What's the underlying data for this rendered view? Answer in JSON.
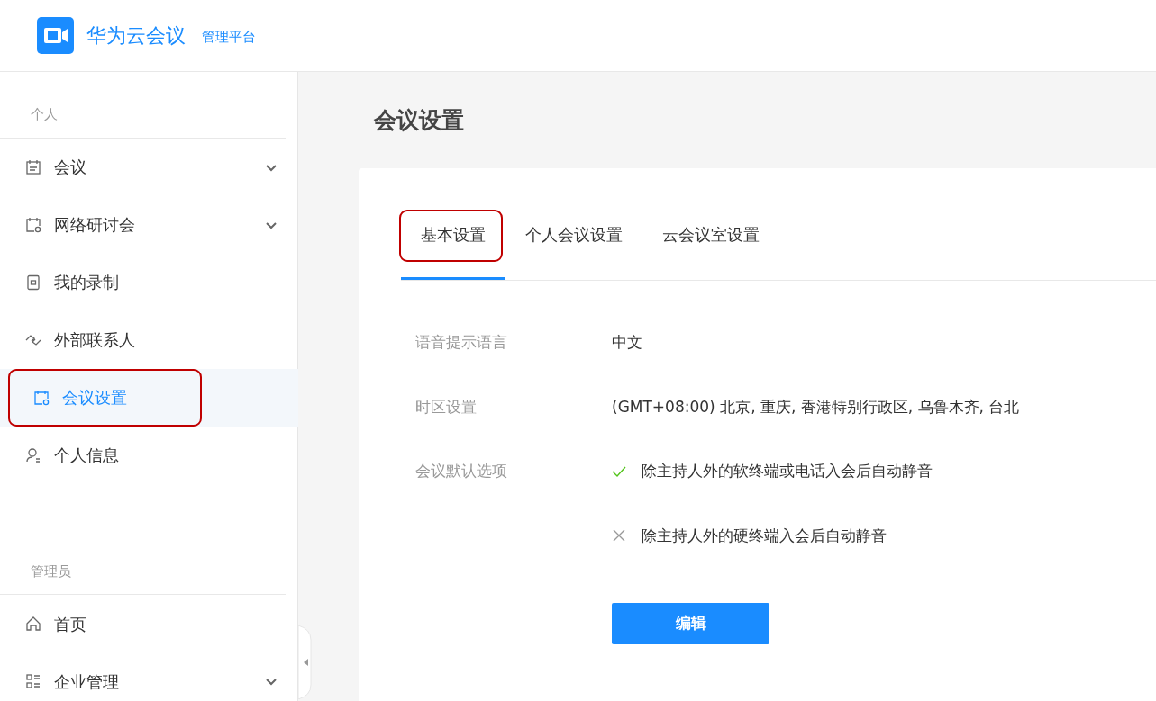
{
  "header": {
    "product": "华为云会议",
    "subtitle": "管理平台"
  },
  "sidebar": {
    "sections": [
      {
        "title": "个人",
        "items": [
          {
            "label": "会议",
            "expandable": true,
            "selected": false,
            "highlighted": false
          },
          {
            "label": "网络研讨会",
            "expandable": true,
            "selected": false,
            "highlighted": false
          },
          {
            "label": "我的录制",
            "expandable": false,
            "selected": false,
            "highlighted": false
          },
          {
            "label": "外部联系人",
            "expandable": false,
            "selected": false,
            "highlighted": false
          },
          {
            "label": "会议设置",
            "expandable": false,
            "selected": true,
            "highlighted": true
          },
          {
            "label": "个人信息",
            "expandable": false,
            "selected": false,
            "highlighted": false
          }
        ]
      },
      {
        "title": "管理员",
        "items": [
          {
            "label": "首页",
            "expandable": false,
            "selected": false,
            "highlighted": false
          },
          {
            "label": "企业管理",
            "expandable": true,
            "selected": false,
            "highlighted": false
          }
        ]
      }
    ]
  },
  "page": {
    "title": "会议设置"
  },
  "tabs": [
    {
      "label": "基本设置",
      "selected": true,
      "highlighted": true
    },
    {
      "label": "个人会议设置",
      "selected": false,
      "highlighted": false
    },
    {
      "label": "云会议室设置",
      "selected": false,
      "highlighted": false
    }
  ],
  "settings": [
    {
      "label": "语音提示语言",
      "values": [
        {
          "kind": "text",
          "text": "中文"
        }
      ]
    },
    {
      "label": "时区设置",
      "values": [
        {
          "kind": "text",
          "text": "(GMT+08:00) 北京, 重庆, 香港特别行政区, 乌鲁木齐, 台北"
        }
      ]
    },
    {
      "label": "会议默认选项",
      "values": [
        {
          "kind": "option",
          "text": "除主持人外的软终端或电话入会后自动静音",
          "checked": true
        },
        {
          "kind": "option",
          "text": "除主持人外的硬终端入会后自动静音",
          "checked": false
        }
      ]
    }
  ],
  "edit_button": "编辑"
}
